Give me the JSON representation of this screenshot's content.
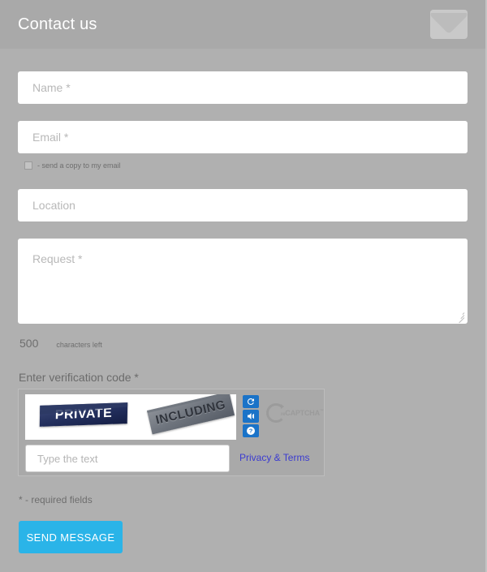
{
  "header": {
    "title": "Contact us",
    "icon": "envelope-icon"
  },
  "form": {
    "name": {
      "placeholder": "Name *",
      "value": ""
    },
    "email": {
      "placeholder": "Email *",
      "value": ""
    },
    "copy_checkbox": {
      "label": "- send a copy to my email",
      "checked": false
    },
    "location": {
      "placeholder": "Location",
      "value": ""
    },
    "request": {
      "placeholder": "Request *",
      "value": ""
    },
    "counter": {
      "number": "500",
      "text": "characters left"
    },
    "captcha_label": "Enter verification code *",
    "required_note": "* - required fields",
    "submit_label": "SEND MESSAGE"
  },
  "recaptcha": {
    "word_one": "PRIVATE",
    "word_two": "INCLUDING",
    "input_placeholder": "Type the text",
    "privacy_link": "Privacy & Terms",
    "logo_re": "re",
    "logo_name": "CAPTCHA",
    "logo_tm": "™",
    "buttons": [
      {
        "name": "refresh-icon",
        "title": "Get a new challenge"
      },
      {
        "name": "audio-icon",
        "title": "Get an audio challenge"
      },
      {
        "name": "help-icon",
        "title": "Help"
      }
    ]
  },
  "colors": {
    "page_background": "#b0b0b0",
    "header_background": "#a9a9a9",
    "accent_button": "#2ab4e8",
    "link": "#3b3bd0",
    "recaptcha_button": "#1a73c8",
    "field_background": "#ffffff"
  }
}
